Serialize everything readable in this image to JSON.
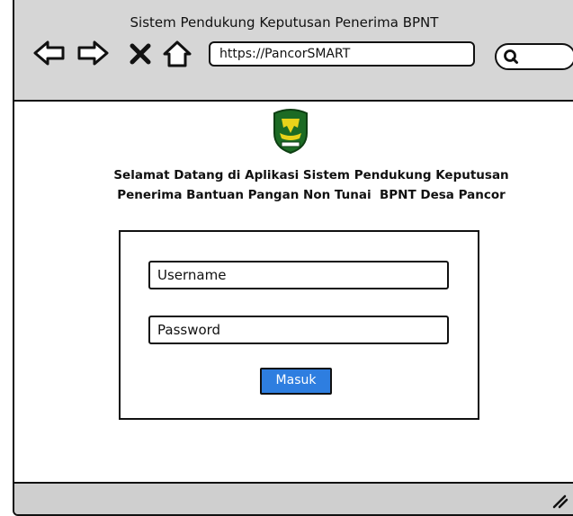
{
  "window": {
    "title": "Sistem Pendukung Keputusan Penerima BPNT"
  },
  "toolbar": {
    "back_icon": "left-arrow-icon",
    "forward_icon": "right-arrow-icon",
    "stop_icon": "x-close-icon",
    "home_icon": "home-icon",
    "url": "https://PancorSMART",
    "search_icon": "search-icon"
  },
  "page": {
    "logo": "regency-crest-logo",
    "welcome_line1": "Selamat Datang di Aplikasi Sistem Pendukung Keputusan",
    "welcome_line2": "Penerima Bantuan Pangan Non Tunai  BPNT Desa Pancor"
  },
  "login": {
    "username_placeholder": "Username",
    "password_placeholder": "Password",
    "submit_label": "Masuk"
  },
  "colors": {
    "chrome_bg": "#d6d6d6",
    "button_bg": "#2e7ee0",
    "logo_green": "#1c6b24",
    "logo_gold": "#e8d21a"
  }
}
